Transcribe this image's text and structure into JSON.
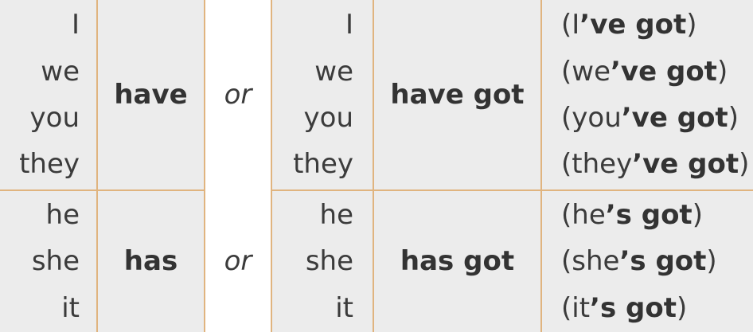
{
  "rows": [
    {
      "pronouns": [
        "I",
        "we",
        "you",
        "they"
      ],
      "verb": "have",
      "or": "or",
      "pronouns_repeat": [
        "I",
        "we",
        "you",
        "they"
      ],
      "verb_got": "have got",
      "contractions": [
        {
          "open": "(I",
          "bold": "’ve got",
          "close": ")"
        },
        {
          "open": "(we",
          "bold": "’ve got",
          "close": ")"
        },
        {
          "open": "(you",
          "bold": "’ve got",
          "close": ")"
        },
        {
          "open": "(they",
          "bold": "’ve got",
          "close": ")"
        }
      ]
    },
    {
      "pronouns": [
        "he",
        "she",
        "it"
      ],
      "verb": "has",
      "or": "or",
      "pronouns_repeat": [
        "he",
        "she",
        "it"
      ],
      "verb_got": "has got",
      "contractions": [
        {
          "open": "(he",
          "bold": "’s got",
          "close": ")"
        },
        {
          "open": "(she",
          "bold": "’s got",
          "close": ")"
        },
        {
          "open": "(it",
          "bold": "’s got",
          "close": ")"
        }
      ]
    }
  ],
  "colors": {
    "cell_background": "#ececec",
    "or_column_background": "#ffffff",
    "rule_color": "#e0b47f"
  }
}
